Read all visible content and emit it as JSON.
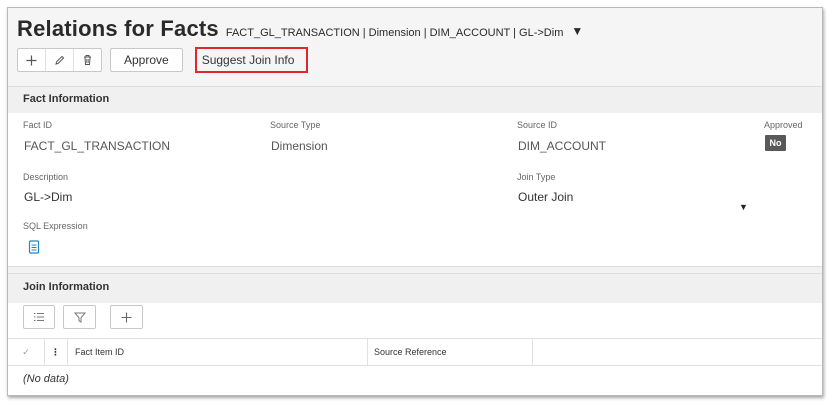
{
  "header": {
    "title": "Relations for Facts",
    "context_path": "FACT_GL_TRANSACTION | Dimension | DIM_ACCOUNT | GL->Dim",
    "context_dropdown_icon": "caret-down-icon"
  },
  "toolbar": {
    "add_icon": "plus-icon",
    "edit_icon": "pencil-icon",
    "delete_icon": "trash-icon",
    "approve_label": "Approve",
    "suggest_label": "Suggest Join Info",
    "highlight_color": "#e0272a"
  },
  "fact_info": {
    "section_title": "Fact Information",
    "fact_id_label": "Fact ID",
    "fact_id_value": "FACT_GL_TRANSACTION",
    "source_type_label": "Source Type",
    "source_type_value": "Dimension",
    "source_id_label": "Source ID",
    "source_id_value": "DIM_ACCOUNT",
    "approved_label": "Approved",
    "approved_value": "No",
    "description_label": "Description",
    "description_value": "GL->Dim",
    "join_type_label": "Join Type",
    "join_type_value": "Outer Join",
    "sql_label": "SQL Expression",
    "sql_icon": "document-icon"
  },
  "join_info": {
    "section_title": "Join Information",
    "tool_icons": [
      "list-icon",
      "filter-icon",
      "plus-icon"
    ],
    "columns": [
      "Fact Item ID",
      "Source Reference"
    ],
    "empty_text": "(No data)"
  }
}
